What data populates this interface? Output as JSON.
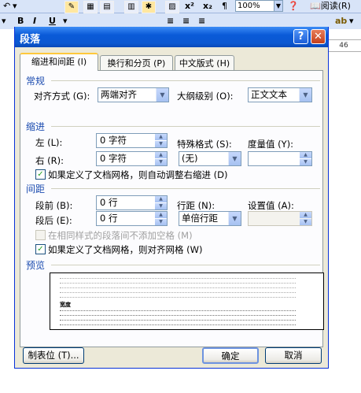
{
  "toolbar": {
    "zoom_value": "100%",
    "read_label": "阅读",
    "read_key": "(R)",
    "ruler_number": "46"
  },
  "dialog": {
    "title": "段落",
    "help_glyph": "?",
    "close_glyph": "✕",
    "tabs": [
      {
        "label": "缩进和间距 (I)"
      },
      {
        "label": "换行和分页 (P)"
      },
      {
        "label": "中文版式 (H)"
      }
    ],
    "general": {
      "section": "常规",
      "alignment_label": "对齐方式 (G):",
      "alignment_value": "两端对齐",
      "outline_label": "大纲级别 (O):",
      "outline_value": "正文文本"
    },
    "indent": {
      "section": "缩进",
      "left_label": "左 (L):",
      "left_value": "0 字符",
      "right_label": "右 (R):",
      "right_value": "0 字符",
      "special_label": "特殊格式 (S):",
      "special_value": "(无)",
      "by_label": "度量值 (Y):",
      "by_value": "",
      "grid_check_label": "如果定义了文档网格，则自动调整右缩进 (D)"
    },
    "spacing": {
      "section": "间距",
      "before_label": "段前 (B):",
      "before_value": "0 行",
      "after_label": "段后 (E):",
      "after_value": "0 行",
      "line_label": "行距 (N):",
      "line_value": "单倍行距",
      "at_label": "设置值 (A):",
      "at_value": "",
      "same_style_label": "在相同样式的段落间不添加空格 (M)",
      "snap_grid_label": "如果定义了文档网格，则对齐网格 (W)"
    },
    "preview": {
      "section": "预览",
      "sample_word": "宽度"
    },
    "buttons": {
      "tabs_label": "制表位 (T)...",
      "ok_label": "确定",
      "cancel_label": "取消"
    }
  }
}
